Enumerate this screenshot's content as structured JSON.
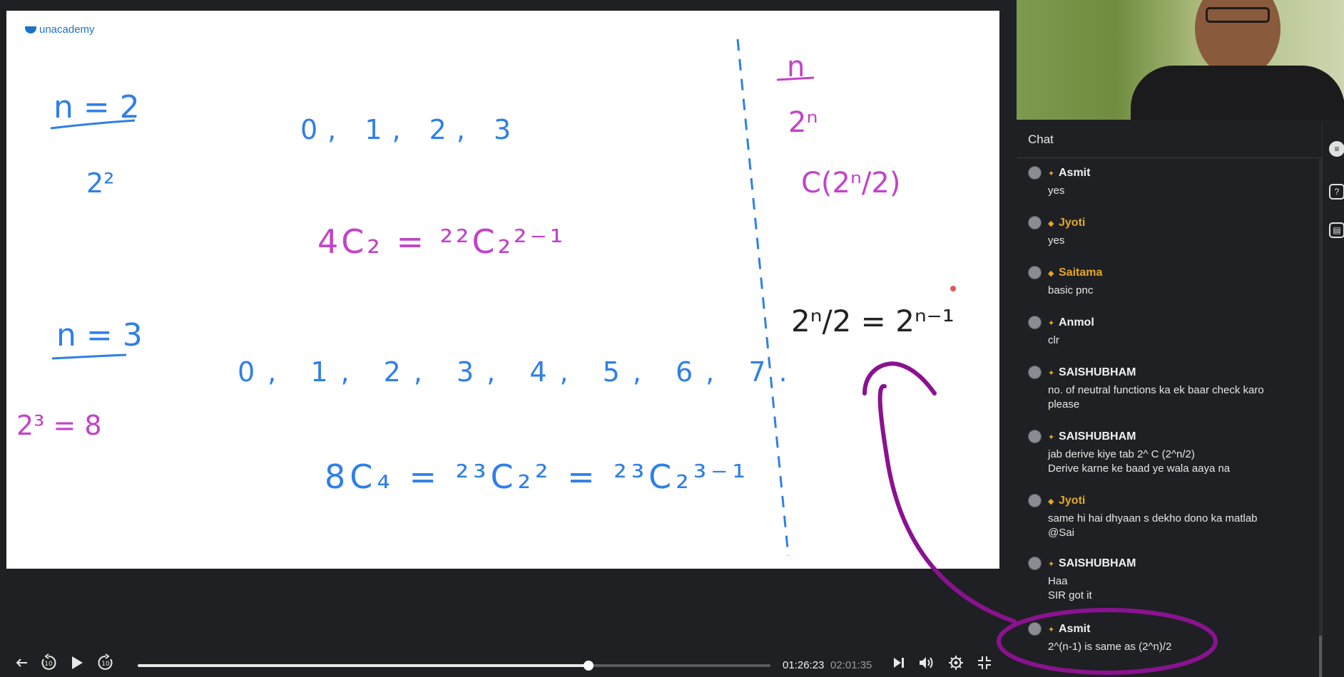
{
  "brand": {
    "name": "unacademy"
  },
  "board": {
    "left": {
      "n2_label": "n = 2",
      "pow_2_2": "2²",
      "n3_label": "n = 3",
      "pow_2_3_eq_8": "2³ = 8"
    },
    "center": {
      "seq4": "0, 1, 2, 3",
      "eq_4c2": "4C₂ = ²²C₂²⁻¹",
      "seq8": "0, 1, 2, 3, 4, 5, 6, 7.",
      "eq_8c4": "8C₄ = ²³C₂² = ²³C₂³⁻¹"
    },
    "right": {
      "n": "n",
      "two_n": "2ⁿ",
      "c_half": "C(2ⁿ/2)",
      "identity": "2ⁿ/2 = 2ⁿ⁻¹"
    }
  },
  "chat": {
    "title": "Chat",
    "messages": [
      {
        "name": "Asmit",
        "highlight": false,
        "badge": "plus",
        "text": [
          "yes"
        ]
      },
      {
        "name": "Jyoti",
        "highlight": true,
        "badge": "diamond",
        "text": [
          "yes"
        ]
      },
      {
        "name": "Saitama",
        "highlight": true,
        "badge": "diamond",
        "text": [
          "basic pnc"
        ]
      },
      {
        "name": "Anmol",
        "highlight": false,
        "badge": "plus",
        "text": [
          "clr"
        ]
      },
      {
        "name": "SAISHUBHAM",
        "highlight": false,
        "badge": "plus",
        "text": [
          "no. of neutral functions ka ek baar check karo",
          "please"
        ]
      },
      {
        "name": "SAISHUBHAM",
        "highlight": false,
        "badge": "plus",
        "text": [
          "jab derive kiye tab 2^ C (2^n/2)",
          "Derive karne ke baad ye wala aaya na"
        ]
      },
      {
        "name": "Jyoti",
        "highlight": true,
        "badge": "diamond",
        "text": [
          "same hi hai dhyaan s dekho dono ka matlab",
          "@Sai"
        ]
      },
      {
        "name": "SAISHUBHAM",
        "highlight": false,
        "badge": "plus",
        "text": [
          "Haa",
          "SIR got it"
        ]
      },
      {
        "name": "Asmit",
        "highlight": false,
        "badge": "plus",
        "text": [
          "2^(n-1) is same as (2^n)/2"
        ]
      }
    ]
  },
  "player": {
    "current_time": "01:26:23",
    "total_time": "02:01:35",
    "progress": 0.7126,
    "skip_back_label": "10",
    "skip_fwd_label": "10"
  },
  "colors": {
    "ink_blue": "#2f7fe8",
    "ink_pink": "#c243c9",
    "annotation_purple": "#8a1290",
    "chat_bg": "#1f2023",
    "accent_gold": "#e3a82b"
  },
  "icons": {
    "back": "arrow-left-icon",
    "rewind": "rewind-10-icon",
    "play": "play-icon",
    "forward": "forward-10-icon",
    "next": "next-icon",
    "volume": "volume-icon",
    "settings": "gear-icon",
    "fullscreen": "exit-fullscreen-icon"
  }
}
